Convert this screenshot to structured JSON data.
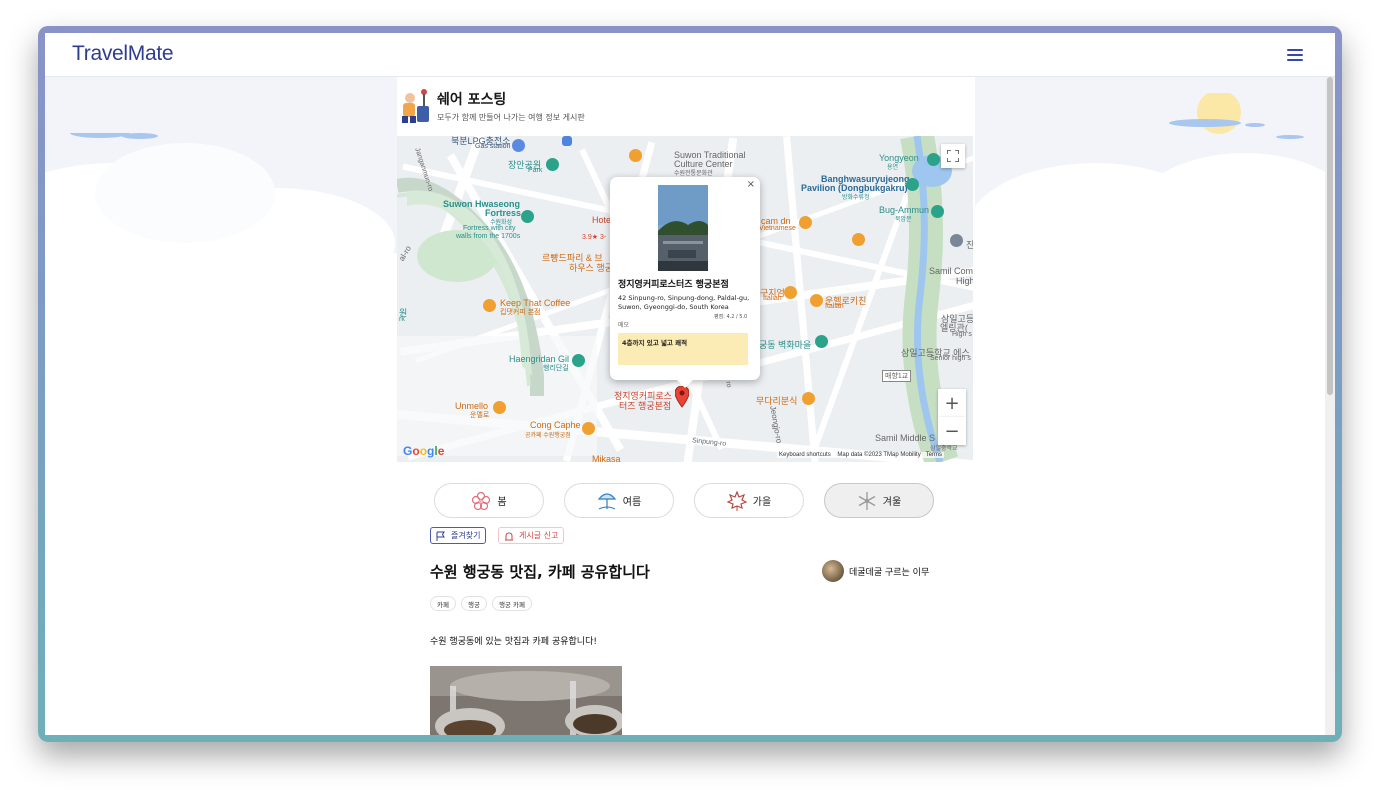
{
  "app": {
    "logo": "TravelMate"
  },
  "board": {
    "title": "쉐어 포스팅",
    "subtitle": "모두가 함께 만들어 나가는 여행 정보 게시판"
  },
  "map": {
    "labels": {
      "lpg": "북분LPG충전소",
      "gas": "Gas station",
      "janganpark": "장안공원",
      "park": "Park",
      "suwonTrad": "Suwon Traditional",
      "cultureCenter": "Culture Center",
      "cultureKo": "수원전통문화관",
      "yongyeon": "Yongyeon",
      "yongyeonKo": "용연",
      "banghwa": "Banghwasuryujeong",
      "pavilion": "Pavilion (Dongbukgakru)",
      "banghwaKo": "방화수류정",
      "bugammun": "Bug-Ammun",
      "bugammunKo": "북암문",
      "hwaseong": "Suwon Hwaseong",
      "fortress": "Fortress",
      "hwaseongKo": "수원화성",
      "fortressCity": "Fortress with city",
      "walls": "walls from the 1700s",
      "hotel": "Hote",
      "rating": "3.9★ 3-",
      "camdn": "cam dn",
      "vietnamese": "Vietnamese",
      "rembrandt": "르빵드파리 & 브",
      "house": "하우스 행궁",
      "keepthat": "Keep That Coffee",
      "keepthatKo": "킵댓커피 본점",
      "samilCom": "Samil Com",
      "high": "High",
      "samil1": "삼일고등",
      "elling": "엘링관(",
      "highs": "High s",
      "jijium": "구지엄",
      "italian": "Italian",
      "unhelroki": "운헬로키친",
      "italian2": "Italian",
      "gonghyang": "궁동 벽화마을",
      "samilHigh": "삼일고등학교 에스",
      "seniorHigh": "Senior high s",
      "haengridan": "Haengridan Gil",
      "haengridanKo": "행리단길",
      "maehyang": "매향1교",
      "unmello": "Unmello",
      "unmelloKo": "운멜로",
      "markerLabel1": "정지영커피로스",
      "markerLabel2": "터즈 행궁본점",
      "mudari": "무다리분식",
      "congcaphe": "Cong Caphe",
      "congcapheKo": "공카페 수원행궁점",
      "sinpung": "Sinpung-ro",
      "jeongjo": "Jeongjo-ro",
      "samilMiddle": "Samil Middle S",
      "samilMiddleKo": "삼일중학교",
      "mikasa": "Mikasa",
      "jangan": "Janganmun-ro",
      "alro": "al-ro",
      "won": "원",
      "rk": "rk",
      "ro": "ro",
      "jin": "진"
    },
    "popup": {
      "title": "정지영커피로스터즈 행궁본점",
      "address": "42 Sinpung-ro, Sinpung-dong, Paldal-gu, Suwon, Gyeonggi-do, South Korea",
      "rating": "평점: 4.2 / 5.0",
      "memo_label": "메모",
      "memo": "4층까지 있고 넓고 쾌적",
      "close": "×"
    },
    "google": "Google",
    "attribution": {
      "shortcuts": "Keyboard shortcuts",
      "data": "Map data ©2023 TMap Mobility",
      "terms": "Terms"
    },
    "zoom_in": "+",
    "zoom_out": "−"
  },
  "seasons": [
    {
      "label": "봄",
      "icon": "flower-icon",
      "color": "#e36d7c",
      "active": false
    },
    {
      "label": "여름",
      "icon": "beach-umbrella-icon",
      "color": "#2f7fc1",
      "active": false
    },
    {
      "label": "가을",
      "icon": "maple-leaf-icon",
      "color": "#b24b43",
      "active": false
    },
    {
      "label": "겨울",
      "icon": "snowflake-icon",
      "color": "#9a9a9a",
      "active": true
    }
  ],
  "actions": {
    "favorite": "즐겨찾기",
    "report": "게시글 신고"
  },
  "post": {
    "title": "수원 행궁동 맛집, 카페 공유합니다",
    "author": "데굴데굴 구르는 이무",
    "tags": [
      "카페",
      "행궁",
      "행궁 카페"
    ],
    "body": "수원 행궁동에 있는 맛집과 카페 공유합니다!"
  },
  "colors": {
    "brand": "#2f3d8f",
    "accent": "#3848a8",
    "memo": "#fbebb4",
    "report": "#d04646"
  }
}
